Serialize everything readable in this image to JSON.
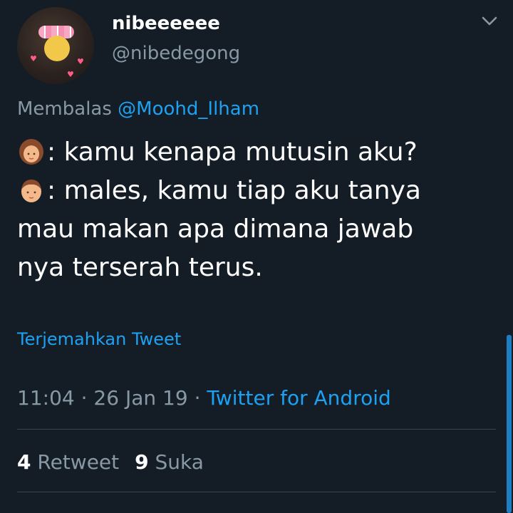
{
  "author": {
    "display_name": "nibeeeeee",
    "handle": "@nibedegong",
    "avatar_icon": "avatar-emoji-flower-crown"
  },
  "reply": {
    "prefix": "Membalas",
    "mention": "@Moohd_Ilham"
  },
  "body": {
    "line1": ": kamu kenapa mutusin aku?",
    "line2": ": males, kamu tiap aku tanya",
    "line3": "mau makan apa dimana jawab",
    "line4": "nya terserah terus.",
    "emoji1": "woman-emoji-icon",
    "emoji2": "boy-emoji-icon"
  },
  "translate_label": "Terjemahkan Tweet",
  "meta": {
    "time": "11:04",
    "date": "26 Jan 19",
    "source": "Twitter for Android"
  },
  "stats": {
    "retweets": "4",
    "retweet_label": "Retweet",
    "likes": "9",
    "like_label": "Suka"
  },
  "colors": {
    "background": "#141d26",
    "accent": "#1da1f2",
    "secondary_text": "#8899a6"
  }
}
